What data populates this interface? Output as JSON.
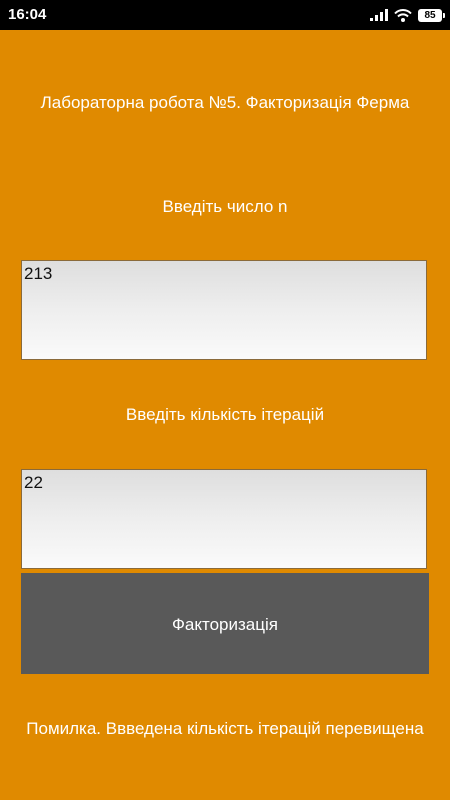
{
  "status_bar": {
    "time": "16:04",
    "battery": "85",
    "icons": [
      "signal-icon",
      "wifi-icon",
      "battery-icon"
    ]
  },
  "screen": {
    "title": "Лабораторна робота №5. Факторизація Ферма",
    "number_label": "Введіть число n",
    "number_value": "213",
    "iterations_label": "Введіть кількість ітерацій",
    "iterations_value": "22",
    "button_label": "Факторизація",
    "result_message": "Помилка. Ввведена кількість ітерацій перевищена"
  },
  "colors": {
    "background": "#e08a00",
    "button": "#595959",
    "text": "#ffffff"
  }
}
